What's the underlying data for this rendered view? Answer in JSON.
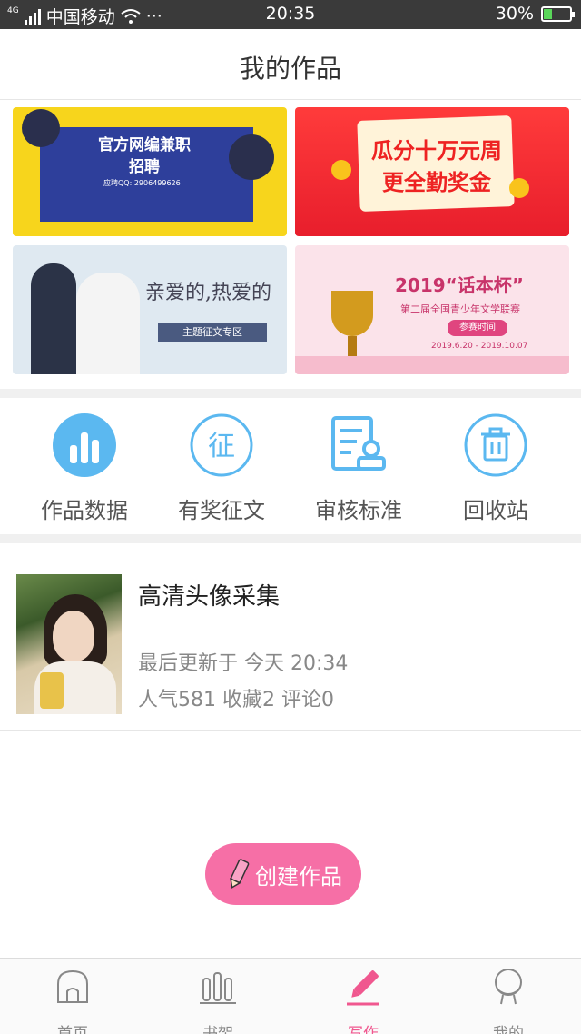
{
  "status_bar": {
    "network": "4G",
    "carrier": "中国移动",
    "more": "···",
    "time": "20:35",
    "battery": "30%",
    "battery_level": 0.3
  },
  "header": {
    "title": "我的作品"
  },
  "banners": [
    {
      "title": "官方网编兼职招聘",
      "qq": "应聘QQ: 2906499626"
    },
    {
      "title": "瓜分十万元周更全勤奖金"
    },
    {
      "title": "亲爱的,热爱的",
      "tag": "主题征文专区"
    },
    {
      "title": "2019“话本杯”",
      "sub": "第二届全国青少年文学联赛",
      "button": "参赛时间",
      "dates": "2019.6.20 - 2019.10.07"
    }
  ],
  "features": [
    {
      "label": "作品数据",
      "icon": "chart-icon"
    },
    {
      "label": "有奖征文",
      "icon": "contest-icon"
    },
    {
      "label": "审核标准",
      "icon": "review-icon"
    },
    {
      "label": "回收站",
      "icon": "trash-icon"
    }
  ],
  "work": {
    "title": "高清头像采集",
    "updated": "最后更新于 今天 20:34",
    "stats": "人气581  收藏2  评论0"
  },
  "create_button": {
    "label": "创建作品"
  },
  "tabbar": [
    {
      "label": "首页",
      "icon": "home-icon",
      "active": false
    },
    {
      "label": "书架",
      "icon": "bookshelf-icon",
      "active": false
    },
    {
      "label": "写作",
      "icon": "pencil-icon",
      "active": true
    },
    {
      "label": "我的",
      "icon": "profile-icon",
      "active": false
    }
  ],
  "colors": {
    "accent_blue": "#5bb8f0",
    "accent_pink": "#f0578f",
    "button_pink": "#f66fa6"
  }
}
